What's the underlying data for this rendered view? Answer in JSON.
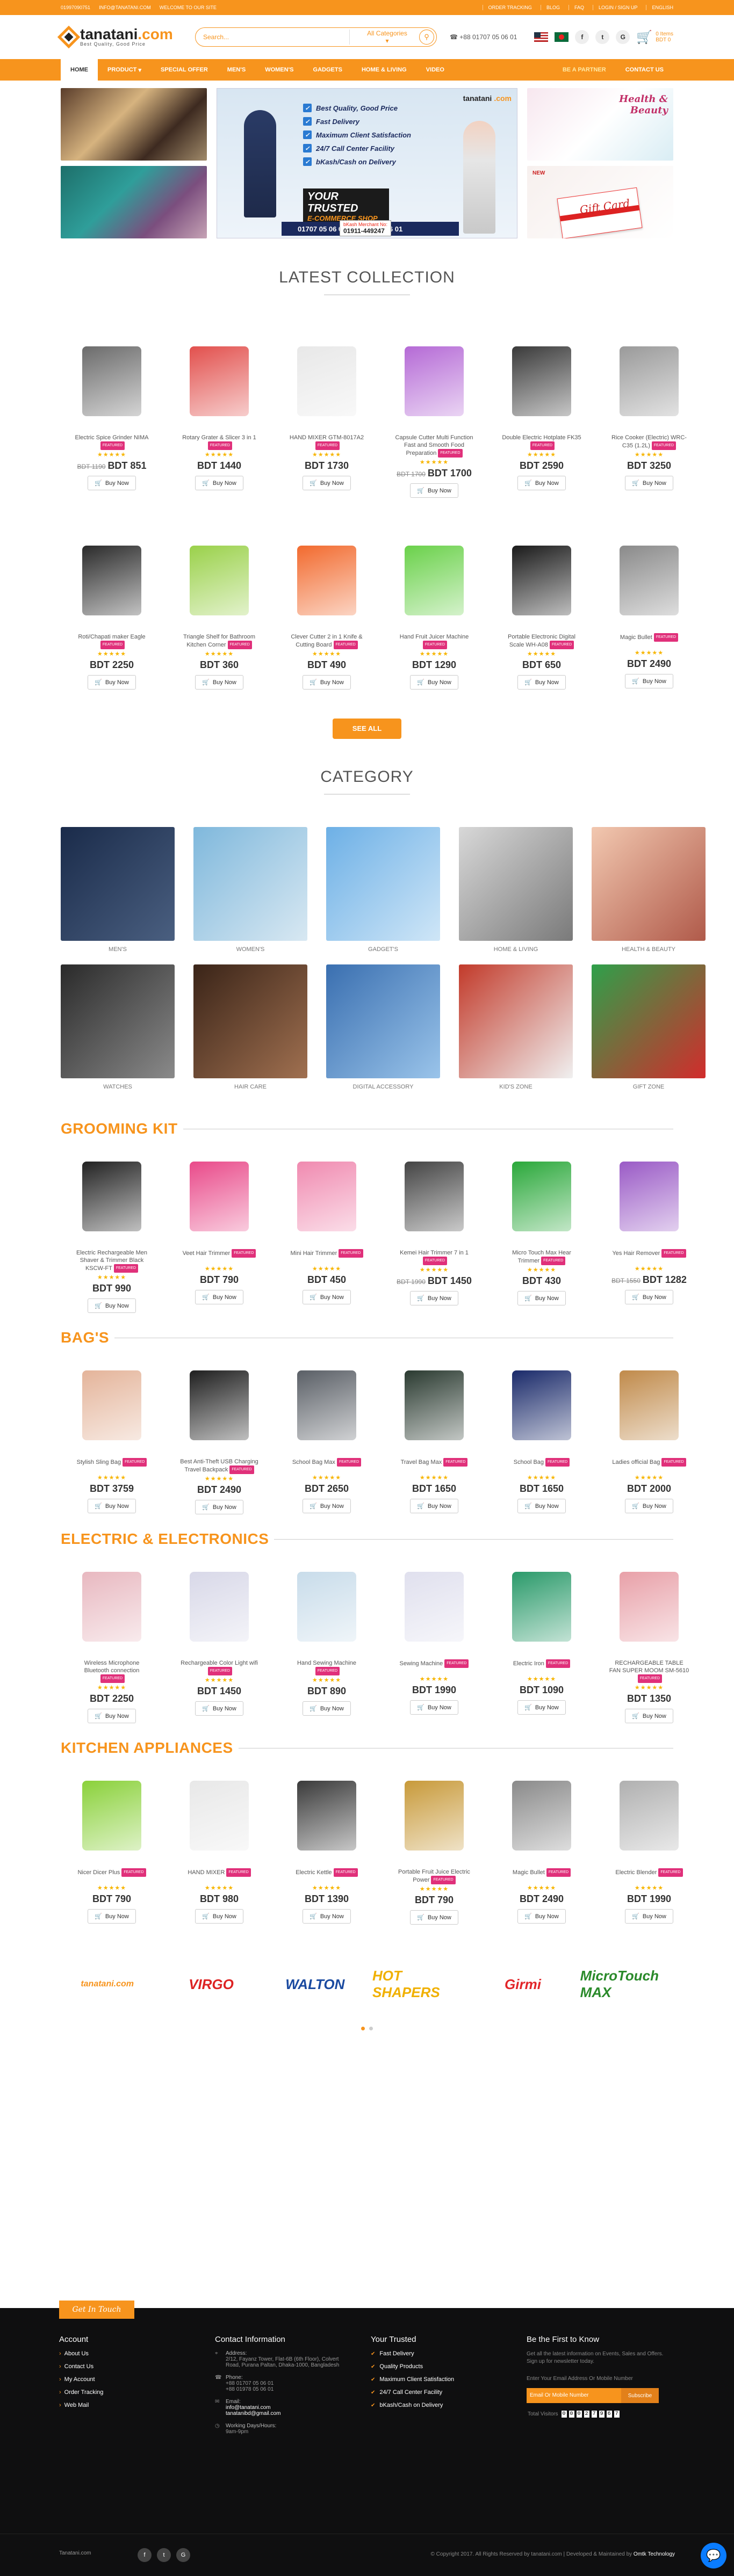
{
  "topbar": {
    "phone": "01997090751",
    "email": "INFO@TANATANI.COM",
    "welcome": "WELCOME TO OUR SITE",
    "links": [
      "ORDER TRACKING",
      "BLOG",
      "FAQ",
      "LOGIN / SIGN UP",
      "ENGLISH"
    ]
  },
  "header": {
    "brand": "tanatani",
    "brand_tld": ".com",
    "tagline": "Best Quality, Good Price",
    "search_placeholder": "Search...",
    "category_select": "All Categories",
    "phone": "+88 01707 05 06 01",
    "cart_label": "Items",
    "cart_count": "0",
    "cart_amount": "BDT 0"
  },
  "nav": {
    "items": [
      "HOME",
      "PRODUCT",
      "SPECIAL OFFER",
      "MEN'S",
      "WOMEN'S",
      "GADGETS",
      "HOME & LIVING",
      "VIDEO"
    ],
    "partner": "BE A PARTNER",
    "contact": "CONTACT US"
  },
  "banner": {
    "points": [
      "Best Quality, Good Price",
      "Fast Delivery",
      "Maximum Client Satisfaction",
      "24/7 Call Center Facility",
      "bKash/Cash on Delivery"
    ],
    "trusted_1": "YOUR TRUSTED",
    "trusted_2": "E-COMMERCE SHOP",
    "merchant_label": "bKash Merchant No:",
    "merchant_no": "01911-449247",
    "phones": "01707 05 06 01 || 01978 05 06 01",
    "beauty_1": "Health &",
    "beauty_2": "Beauty",
    "gift": "Gift Card",
    "gift_note": "NEW"
  },
  "latest": {
    "title": "LATEST COLLECTION",
    "see_all": "SEE ALL",
    "products": [
      {
        "name": "Electric Spice Grinder NIMA",
        "badge": "FEATURED",
        "old": "BDT 1190",
        "price": "BDT 851",
        "img": "#6b6b6b"
      },
      {
        "name": "Rotary Grater & Slicer 3 in 1",
        "badge": "FEATURED",
        "old": "",
        "price": "BDT 1440",
        "img": "#e2504d"
      },
      {
        "name": "HAND MIXER GTM-8017A2",
        "badge": "FEATURED",
        "old": "",
        "price": "BDT 1730",
        "img": "#e8e8e8"
      },
      {
        "name": "Capsule Cutter Multi Function Fast and Smooth Food Preparation",
        "badge": "FEATURED",
        "old": "BDT 1700",
        "price": "BDT 1700",
        "img": "#b56ad6"
      },
      {
        "name": "Double Electric Hotplate FK35",
        "badge": "FEATURED",
        "old": "",
        "price": "BDT 2590",
        "img": "#3a3a3a"
      },
      {
        "name": "Rice Cooker (Electric) WRC-C35 (1.2L)",
        "badge": "FEATURED",
        "old": "",
        "price": "BDT 3250",
        "img": "#9a9a9a"
      },
      {
        "name": "Roti/Chapati maker Eagle",
        "badge": "FEATURED",
        "old": "",
        "price": "BDT 2250",
        "img": "#2a2a2a"
      },
      {
        "name": "Triangle Shelf for Bathroom Kitchen Corner",
        "badge": "FEATURED",
        "old": "",
        "price": "BDT 360",
        "img": "#9ad14a"
      },
      {
        "name": "Clever Cutter 2 in 1 Knife & Cutting Board",
        "badge": "FEATURED",
        "old": "",
        "price": "BDT 490",
        "img": "#f26a2e"
      },
      {
        "name": "Hand Fruit Juicer Machine",
        "badge": "FEATURED",
        "old": "",
        "price": "BDT 1290",
        "img": "#6ad14a"
      },
      {
        "name": "Portable Electronic Digital Scale WH-A08",
        "badge": "FEATURED",
        "old": "",
        "price": "BDT 650",
        "img": "#1a1a1a"
      },
      {
        "name": "Magic Bullet",
        "badge": "FEATURED",
        "old": "",
        "price": "BDT 2490",
        "img": "#8a8a8a"
      }
    ]
  },
  "categories": {
    "title": "CATEGORY",
    "items": [
      {
        "name": "MEN'S",
        "c1": "#1a2b4a",
        "c2": "#4a5f80"
      },
      {
        "name": "WOMEN'S",
        "c1": "#7fb8dc",
        "c2": "#d8e8f2"
      },
      {
        "name": "GADGET'S",
        "c1": "#6db0e6",
        "c2": "#cfe6f7"
      },
      {
        "name": "HOME & LIVING",
        "c1": "#d8d8d8",
        "c2": "#7a7a7a"
      },
      {
        "name": "HEALTH & BEAUTY",
        "c1": "#f2c8b0",
        "c2": "#b05a4a"
      },
      {
        "name": "WATCHES",
        "c1": "#2a2a2a",
        "c2": "#8a8a8a"
      },
      {
        "name": "HAIR CARE",
        "c1": "#3a2418",
        "c2": "#a07050"
      },
      {
        "name": "DIGITAL ACCESSORY",
        "c1": "#3a6fb0",
        "c2": "#9ac4ea"
      },
      {
        "name": "KID'S ZONE",
        "c1": "#c23a2a",
        "c2": "#f0f0f0"
      },
      {
        "name": "GIFT ZONE",
        "c1": "#2ea04a",
        "c2": "#d22c2c"
      }
    ]
  },
  "sections": [
    {
      "title": "GROOMING KIT",
      "products": [
        {
          "name": "Electric Rechargeable Men Shaver & Trimmer Black KSCW-FT",
          "badge": "FEATURED",
          "old": "",
          "price": "BDT 990",
          "img": "#222"
        },
        {
          "name": "Veet Hair Trimmer",
          "badge": "FEATURED",
          "old": "",
          "price": "BDT 790",
          "img": "#e94a8a"
        },
        {
          "name": "Mini Hair Trimmer",
          "badge": "FEATURED",
          "old": "",
          "price": "BDT 450",
          "img": "#f08ab0"
        },
        {
          "name": "Kemei Hair Trimmer 7 in 1",
          "badge": "FEATURED",
          "old": "BDT 1990",
          "price": "BDT 1450",
          "img": "#444"
        },
        {
          "name": "Micro Touch Max Hear Trimmer",
          "badge": "FEATURED",
          "old": "",
          "price": "BDT 430",
          "img": "#2aa83a"
        },
        {
          "name": "Yes Hair Remover",
          "badge": "FEATURED",
          "old": "BDT 1550",
          "price": "BDT 1282",
          "img": "#9a5ac6"
        }
      ]
    },
    {
      "title": "BAG'S",
      "products": [
        {
          "name": "Stylish Sling Bag",
          "badge": "FEATURED",
          "old": "",
          "price": "BDT 3759",
          "img": "#e4b49a"
        },
        {
          "name": "Best Anti-Theft USB Charging Travel Backpack",
          "badge": "FEATURED",
          "old": "",
          "price": "BDT 2490",
          "img": "#1f1f1f"
        },
        {
          "name": "School Bag Max",
          "badge": "FEATURED",
          "old": "",
          "price": "BDT 2650",
          "img": "#5a5f66"
        },
        {
          "name": "Travel Bag Max",
          "badge": "FEATURED",
          "old": "",
          "price": "BDT 1650",
          "img": "#2a3a30"
        },
        {
          "name": "School Bag",
          "badge": "FEATURED",
          "old": "",
          "price": "BDT 1650",
          "img": "#1a2a6a"
        },
        {
          "name": "Ladies official Bag",
          "badge": "FEATURED",
          "old": "",
          "price": "BDT 2000",
          "img": "#c08a4a"
        }
      ]
    },
    {
      "title": "ELECTRIC & ELECTRONICS",
      "products": [
        {
          "name": "Wireless Microphone Bluetooth connection",
          "badge": "FEATURED",
          "old": "",
          "price": "BDT 2250",
          "img": "#e8b8c0"
        },
        {
          "name": "Rechargeable Color Light wifi",
          "badge": "FEATURED",
          "old": "",
          "price": "BDT 1450",
          "img": "#d8d8e8"
        },
        {
          "name": "Hand Sewing Machine",
          "badge": "FEATURED",
          "old": "",
          "price": "BDT 890",
          "img": "#c8dcea"
        },
        {
          "name": "Sewing Machine",
          "badge": "FEATURED",
          "old": "",
          "price": "BDT 1990",
          "img": "#e0e0ee"
        },
        {
          "name": "Electric Iron",
          "badge": "FEATURED",
          "old": "",
          "price": "BDT 1090",
          "img": "#2a9a6a"
        },
        {
          "name": "RECHARGEABLE TABLE FAN SUPER MOOM SM-5610",
          "badge": "FEATURED",
          "old": "",
          "price": "BDT 1350",
          "img": "#e8a0a8"
        }
      ]
    },
    {
      "title": "KITCHEN APPLIANCES",
      "products": [
        {
          "name": "Nicer Dicer Plus",
          "badge": "FEATURED",
          "old": "",
          "price": "BDT 790",
          "img": "#8ad13a"
        },
        {
          "name": "HAND MIXER",
          "badge": "FEATURED",
          "old": "",
          "price": "BDT 980",
          "img": "#e8e8e8"
        },
        {
          "name": "Electric Kettle",
          "badge": "FEATURED",
          "old": "",
          "price": "BDT 1390",
          "img": "#3a3a3a"
        },
        {
          "name": "Portable Fruit Juice Electric Power",
          "badge": "FEATURED",
          "old": "",
          "price": "BDT 790",
          "img": "#c89a3a"
        },
        {
          "name": "Magic Bullet",
          "badge": "FEATURED",
          "old": "",
          "price": "BDT 2490",
          "img": "#8a8a8a"
        },
        {
          "name": "Electric Blender",
          "badge": "FEATURED",
          "old": "",
          "price": "BDT 1990",
          "img": "#b0b0b0"
        }
      ]
    }
  ],
  "buy_label": "Buy Now",
  "brands": [
    {
      "name": "tanatani.com",
      "color": "#f7941d"
    },
    {
      "name": "VIRGO",
      "color": "#d22"
    },
    {
      "name": "WALTON",
      "color": "#1a4aa0"
    },
    {
      "name": "HOT SHAPERS",
      "color": "#f0b000"
    },
    {
      "name": "Girmi",
      "color": "#e2262a"
    },
    {
      "name": "MicroTouch MAX",
      "color": "#2a8a2a"
    }
  ],
  "footer": {
    "get_in_touch": "Get In Touch",
    "account_title": "Account",
    "account_links": [
      "About Us",
      "Contact Us",
      "My Account",
      "Order Tracking",
      "Web Mail"
    ],
    "contact_title": "Contact Information",
    "address_label": "Address:",
    "address": "2/12, Fayanz Tower, Flat-6B (6th Floor), Colvert Road, Purana Paltan, Dhaka-1000, Bangladesh",
    "phone_label": "Phone:",
    "phone1": "+88 01707 05 06 01",
    "phone2": "+88 01978 05 06 01",
    "email_label": "Email:",
    "email1": "info@tanatani.com",
    "email2": "tanatanibd@gmail.com",
    "hours_label": "Working Days/Hours:",
    "hours": "9am-9pm",
    "trusted_title": "Your Trusted",
    "trusted": [
      "Fast Delivery",
      "Quality Products",
      "Maximum Client Satisfaction",
      "24/7 Call Center Facility",
      "bKash/Cash on Delivery"
    ],
    "news_title": "Be the First to Know",
    "news_text": "Get all the latest information on Events, Sales and Offers. Sign up for newsletter today.",
    "news_prompt": "Enter Your Email Address Or Mobile Number",
    "news_placeholder": "Email Or Mobile Number",
    "subscribe": "Subscribe",
    "visitors_label": "Total Visitors",
    "visitors": [
      "0",
      "0",
      "0",
      "2",
      "7",
      "9",
      "6",
      "7"
    ],
    "bottom_logo": "Tanatani.com",
    "copyright": "© Copyright 2017. All Rights Reserved by tanatani.com | Developed & Maintained by",
    "developer": "Omtk Technology"
  }
}
